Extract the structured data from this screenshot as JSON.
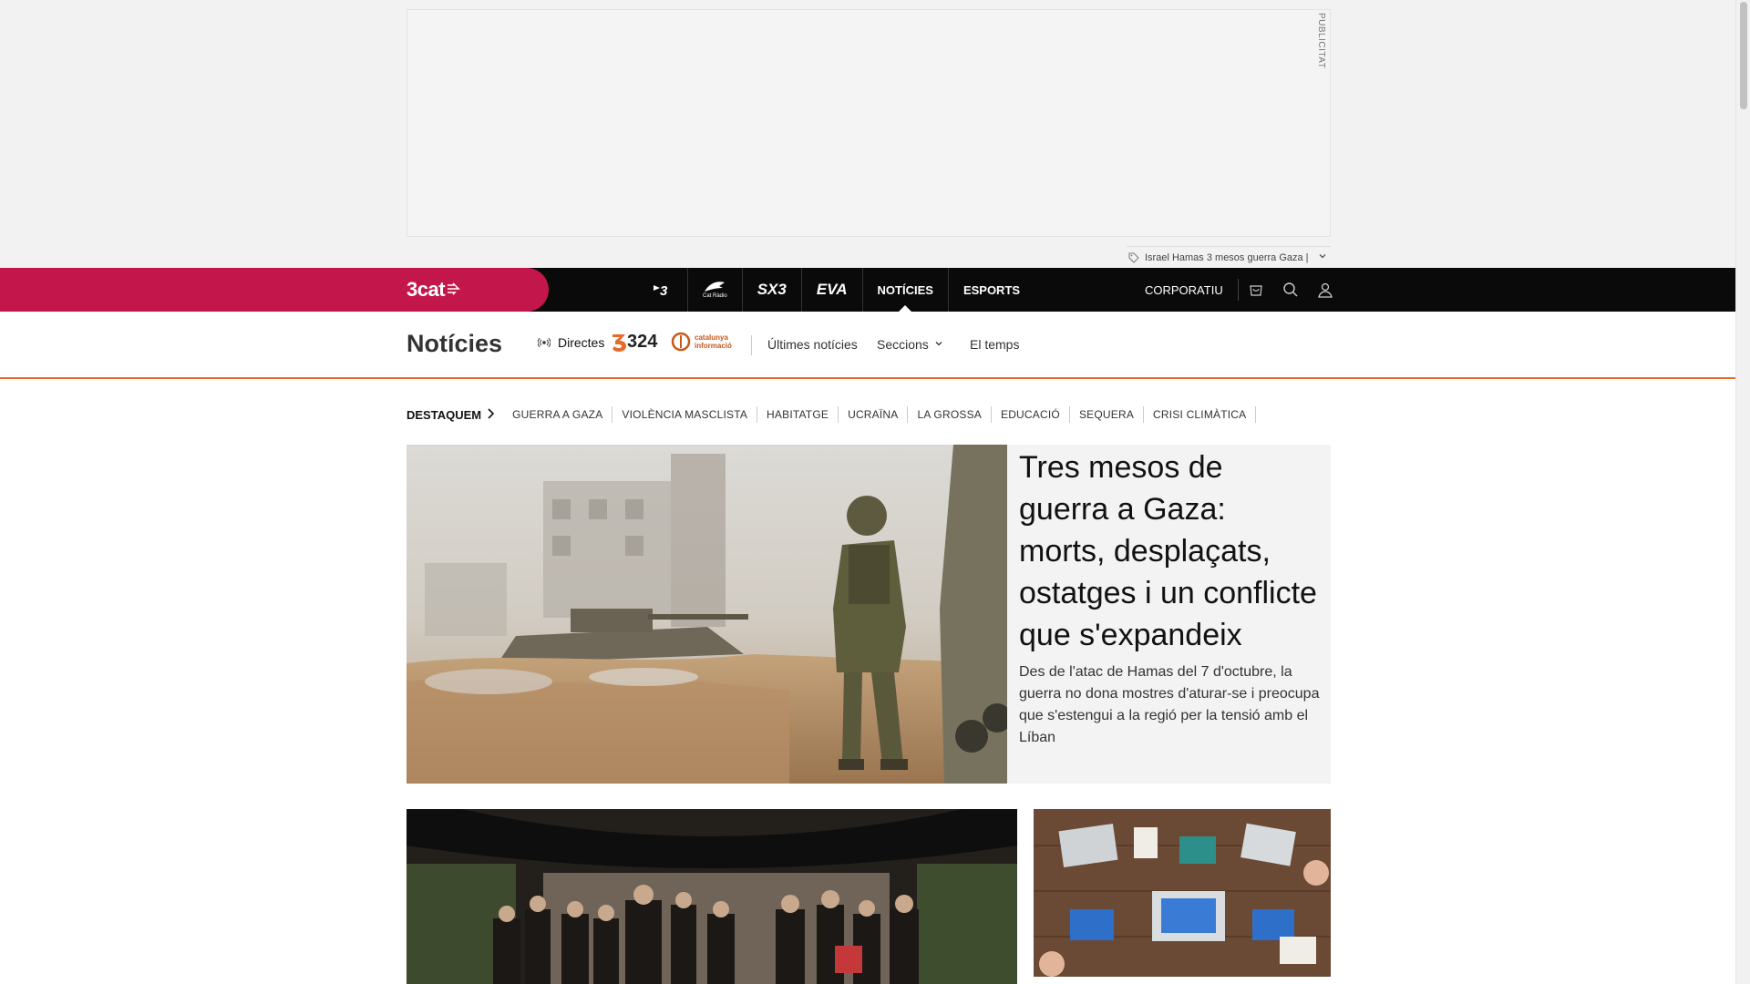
{
  "ad": {
    "label": "PUBLICITAT"
  },
  "breaking": {
    "text": "Israel Hamas 3 mesos guerra Gaza |"
  },
  "topbar": {
    "brand": "3cat",
    "channels": [
      {
        "label": "3"
      },
      {
        "label": "Cat Ràdio"
      },
      {
        "label": "SX3"
      },
      {
        "label": "EVA"
      },
      {
        "label": "NOTÍCIES"
      },
      {
        "label": "ESPORTS"
      }
    ],
    "corporatiu": "CORPORATIU"
  },
  "section_nav": {
    "title": "Notícies",
    "directes": "Directes",
    "logo_324": "324",
    "logo_ci_line1": "catalunya",
    "logo_ci_line2": "informació",
    "ultimes": "Últimes notícies",
    "seccions": "Seccions",
    "temps": "El temps"
  },
  "highlights": {
    "title": "DESTAQUEM",
    "items": [
      "GUERRA A GAZA",
      "VIOLÈNCIA MASCLISTA",
      "HABITATGE",
      "UCRAÏNA",
      "LA GROSSA",
      "EDUCACIÓ",
      "SEQUERA",
      "CRISI CLIMÀTICA"
    ]
  },
  "hero": {
    "headline": "Tres mesos de guerra a Gaza: morts, desplaçats, ostatges i un conflicte que s'expandeix",
    "summary": "Des de l'atac de Hamas del 7 d'octubre, la guerra no dona mostres d'aturar-se i preocupa que s'estengui a la regió per la tensió amb el Líban"
  },
  "colors": {
    "brand_red": "#c3164a",
    "topbar_black": "#0a0a0a",
    "accent_orange": "#e86a2a",
    "hero_bg": "#f3f3f3"
  }
}
